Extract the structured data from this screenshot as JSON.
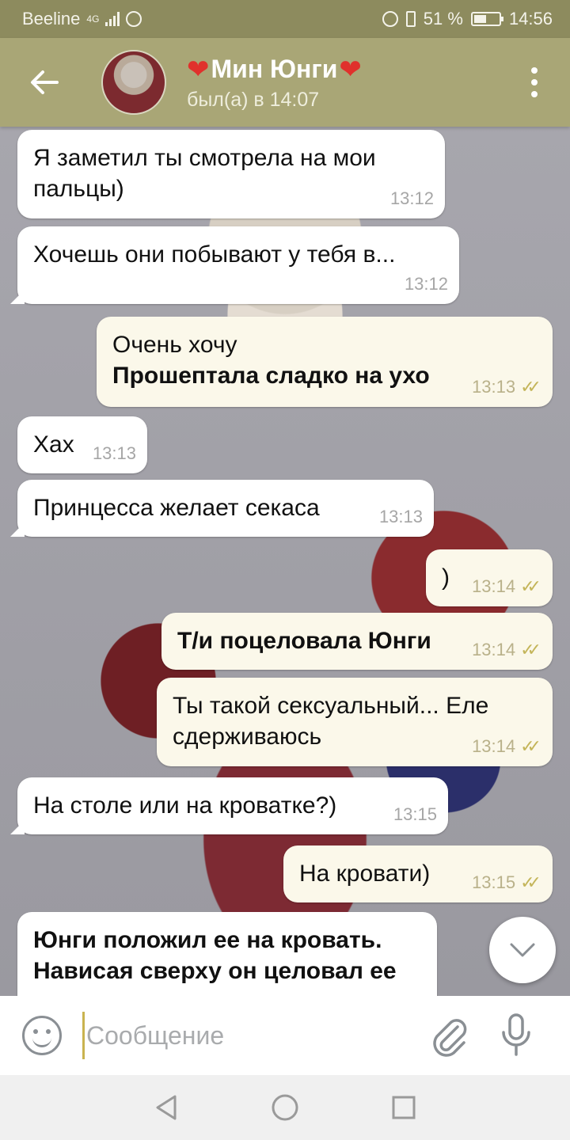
{
  "status_bar": {
    "carrier": "Beeline",
    "network": "4G",
    "battery": "51 %",
    "battery_level": 0.51,
    "time": "14:56"
  },
  "header": {
    "contact_name": "Мин Юнги",
    "heart_left": "❤",
    "heart_right": "❤",
    "last_seen": "был(а) в 14:07"
  },
  "messages": [
    {
      "dir": "in",
      "text": "Я заметил ты смотрела на мои пальцы)",
      "time": "13:12"
    },
    {
      "dir": "in",
      "text": "Хочешь они побывают у тебя в...",
      "time": "13:12"
    },
    {
      "dir": "out",
      "text": "Очень хочу",
      "text_bold": "Прошептала сладко на ухо",
      "time": "13:13",
      "read": "✓✓"
    },
    {
      "dir": "in",
      "text": "Хах",
      "time": "13:13"
    },
    {
      "dir": "in",
      "text": "Принцесса желает секаса",
      "time": "13:13"
    },
    {
      "dir": "out",
      "text": ")",
      "time": "13:14",
      "read": "✓✓"
    },
    {
      "dir": "out",
      "text_bold": "Т/и поцеловала Юнги",
      "time": "13:14",
      "read": "✓✓"
    },
    {
      "dir": "out",
      "text": "Ты такой сексуальный... Еле сдерживаюсь",
      "time": "13:14",
      "read": "✓✓"
    },
    {
      "dir": "in",
      "text": "На столе или на кроватке?)",
      "time": "13:15"
    },
    {
      "dir": "out",
      "text": "На кровати)",
      "time": "13:15",
      "read": "✓✓"
    },
    {
      "dir": "in",
      "text_bold": "Юнги положил ее на кровать. Нависая сверху он целовал ее"
    }
  ],
  "input": {
    "placeholder": "Сообщение",
    "value": ""
  },
  "colors": {
    "header_bg": "#a9a676",
    "status_bg": "#8d8b5e",
    "outgoing_bubble": "#fbf8ea",
    "incoming_bubble": "#ffffff",
    "read_check": "#c4b55a"
  },
  "icons": {
    "back": "arrow-left",
    "menu": "more-vertical",
    "emoji": "smile",
    "attach": "paperclip",
    "mic": "microphone",
    "scroll_down": "chevron-down"
  }
}
